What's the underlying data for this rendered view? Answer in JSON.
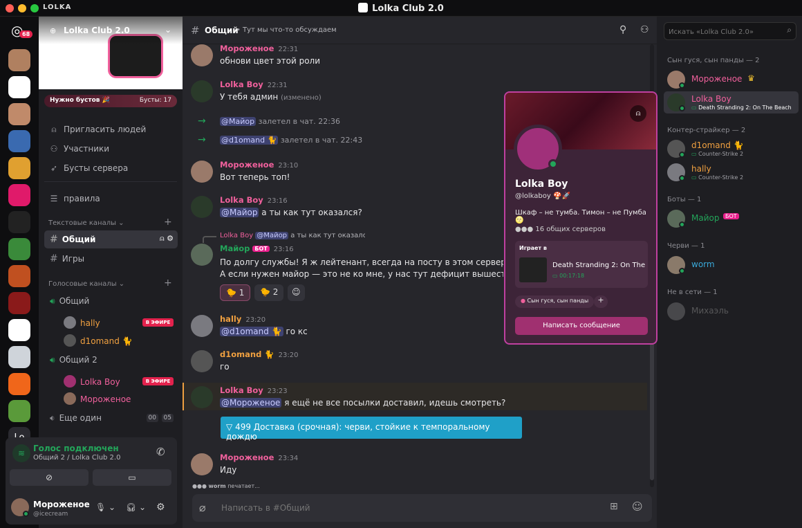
{
  "app": {
    "mini": "LOLKA",
    "title": "Lolka Club 2.0"
  },
  "rail": {
    "badge": "68",
    "lo": "Lo"
  },
  "server": {
    "name": "Lolka Club 2.0",
    "boost_label": "Нужно бустов 🎉",
    "boost_count": "Бусты: 17",
    "nav": [
      {
        "label": "Пригласить людей",
        "icon": "add-user-icon"
      },
      {
        "label": "Участники",
        "icon": "users-icon"
      },
      {
        "label": "Бусты сервера",
        "icon": "rocket-icon"
      },
      {
        "label": "правила",
        "icon": "rules-icon"
      }
    ],
    "text_section": "Текстовые каналы",
    "voice_section": "Голосовые каналы",
    "text_channels": [
      "Общий",
      "Игры"
    ],
    "voice": {
      "ch1": "Общий",
      "ch1_users": [
        "hally",
        "d1omand 🐈"
      ],
      "ch2": "Общий 2",
      "ch2_users": [
        "Lolka Boy",
        "Мороженое"
      ],
      "ch3": "Еще один",
      "ch3_t1": "00",
      "ch3_t2": "05",
      "live": "В ЭФИРЕ"
    }
  },
  "voice_panel": {
    "status": "Голос подключен",
    "location": "Общий 2 / Lolka Club 2.0"
  },
  "user": {
    "name": "Мороженое",
    "handle": "@icecream"
  },
  "channel": {
    "name": "Общий",
    "topic": "Тут мы что-то обсуждаем"
  },
  "search": {
    "placeholder": "Искать «Lolka Club 2.0»"
  },
  "messages": {
    "m1_name": "Мороженое",
    "m1_ts": "22:31",
    "m1_text": "обнови цвет этой роли",
    "m2_name": "Lolka Boy",
    "m2_ts": "22:31",
    "m2_text": "У тебя админ",
    "m2_edit": "(изменено)",
    "s1_mention": "@Майор",
    "s1_text": "залетел в чат. 22:36",
    "s2_mention": "@d1omand 🐈",
    "s2_text": "залетел в чат. 22:43",
    "m3_name": "Мороженое",
    "m3_ts": "23:10",
    "m3_text": "Вот теперь топ!",
    "m4_name": "Lolka Boy",
    "m4_ts": "23:16",
    "m4_mention": "@Майор",
    "m4_text": "а ты как тут оказался?",
    "reply_name": "Lolka Boy",
    "reply_mention": "@Майор",
    "reply_text": "а ты как тут оказался?",
    "m5_name": "Майор",
    "m5_bot": "БОТ",
    "m5_ts": "23:16",
    "m5_line1": "По долгу службы! Я ж лейтенант, всегда на посту в этом сервере. Когда кто-то",
    "m5_line2": "А если нужен майор — это не ко мне, у нас тут дефицит вышестоящих чинов",
    "r1": "1",
    "r2": "2",
    "m6_name": "hally",
    "m6_ts": "23:20",
    "m6_mention": "@d1omand 🐈",
    "m6_text": "го кс",
    "m7_name": "d1omand 🐈",
    "m7_ts": "23:20",
    "m7_text": "го",
    "m8_name": "Lolka Boy",
    "m8_ts": "23:23",
    "m8_mention": "@Мороженое",
    "m8_text": "я ещё не все посылки доставил, идешь смотреть?",
    "quest_num": "499",
    "quest_text": "Доставка (срочная): черви, стойкие к темпоральному дождю",
    "m9_name": "Мороженое",
    "m9_ts": "23:34",
    "m9_text": "Иду",
    "typing_name": "worm",
    "typing_text": "печатает..."
  },
  "input": {
    "placeholder": "Написать в #Общий"
  },
  "profile": {
    "name": "Lolka Boy",
    "handle": "@lolkaboy",
    "status": "Шкаф – не тумба. Тимон – не Пумба 🌝",
    "mutual": "16 общих серверов",
    "playing_label": "Играет в",
    "game": "Death Stranding 2: On The...",
    "game_time": "00:17:18",
    "role": "Сын гуся, сын панды",
    "button": "Написать сообщение"
  },
  "members": {
    "g1": "Сын гуся, сын панды — 2",
    "g2": "Контер-страйкер — 2",
    "g3": "Боты — 1",
    "g4": "Черви — 1",
    "g5": "Не в сети — 1",
    "u1": "Мороженое",
    "u2": "Lolka Boy",
    "u2_act": "Death Stranding 2: On The Beach",
    "u3": "d1omand 🐈",
    "u3_act": "Counter-Strike 2",
    "u4": "hally",
    "u4_act": "Counter-Strike 2",
    "u5": "Майор",
    "u5_bot": "БОТ",
    "u6": "worm",
    "u7": "Михаэль"
  },
  "colors": {
    "pink": "#f0609c",
    "orange": "#f0a040",
    "green": "#23a55a",
    "teal": "#3aa8d8"
  }
}
